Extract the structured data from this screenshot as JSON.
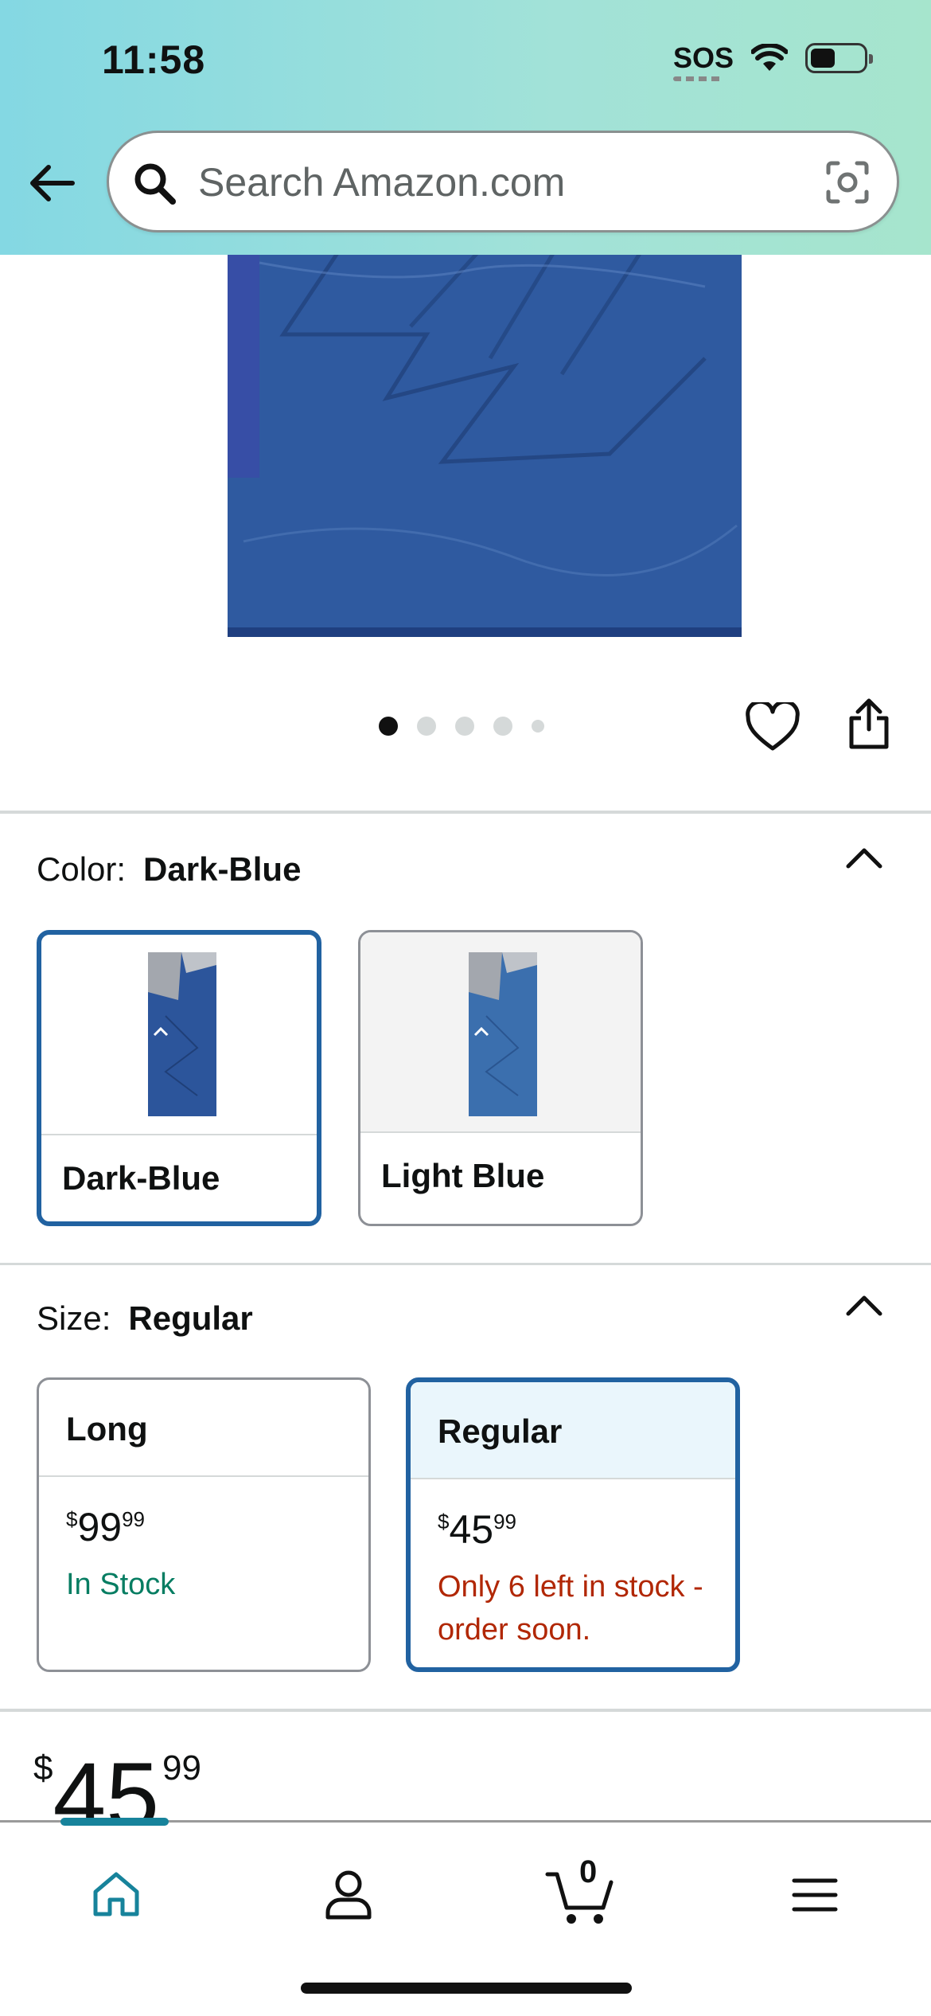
{
  "status_bar": {
    "time": "11:58",
    "sos": "SOS",
    "icons": [
      "wifi-icon",
      "battery-icon"
    ]
  },
  "search": {
    "placeholder": "Search Amazon.com",
    "icons": [
      "back-arrow-icon",
      "search-icon",
      "camera-scan-icon"
    ]
  },
  "gallery": {
    "image_count": 5,
    "active_index": 0,
    "actions": [
      "heart-icon",
      "share-icon"
    ]
  },
  "color": {
    "key": "Color:",
    "value": "Dark-Blue",
    "options": [
      {
        "label": "Dark-Blue",
        "selected": true,
        "swatch_color": "#2c559b"
      },
      {
        "label": "Light Blue",
        "selected": false,
        "swatch_color": "#3b6fae"
      }
    ]
  },
  "size": {
    "key": "Size:",
    "value": "Regular",
    "options": [
      {
        "label": "Long",
        "currency": "$",
        "price_whole": "99",
        "price_cents": "99",
        "stock": "In Stock",
        "selected": false
      },
      {
        "label": "Regular",
        "currency": "$",
        "price_whole": "45",
        "price_cents": "99",
        "stock": "Only 6 left in stock - order soon.",
        "selected": true
      }
    ]
  },
  "price": {
    "currency": "$",
    "whole": "45",
    "cents": "99"
  },
  "bottom_nav": {
    "items": [
      "home-icon",
      "account-icon",
      "cart-icon",
      "menu-icon"
    ],
    "cart_count": "0"
  },
  "colors": {
    "accent_blue": "#2162a1",
    "in_stock_green": "#067d62",
    "low_stock_red": "#b12704",
    "nav_teal": "#17839b"
  }
}
